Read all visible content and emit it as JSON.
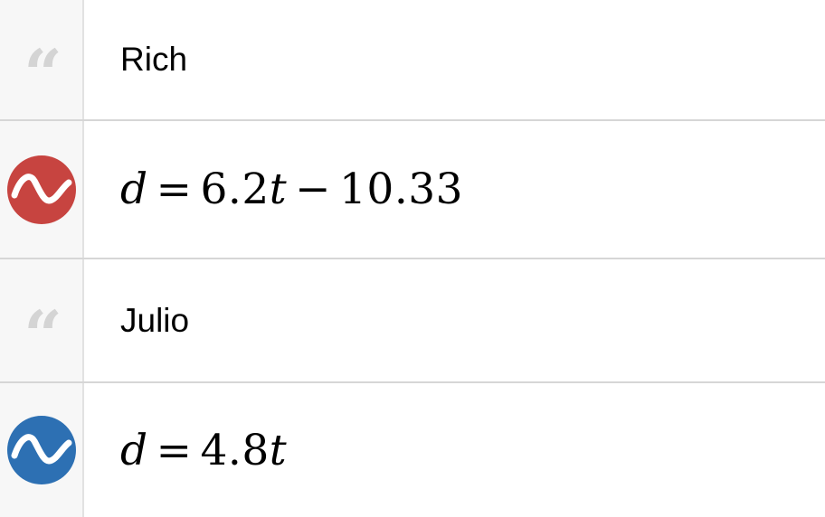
{
  "expressions": [
    {
      "kind": "note",
      "text": "Rich"
    },
    {
      "kind": "expression",
      "color": "#c74440",
      "icon": "sine-wave-icon",
      "lhs": "d",
      "eq": "=",
      "coef": "6.2",
      "var": "t",
      "op": "−",
      "constant": "10.33"
    },
    {
      "kind": "note",
      "text": "Julio"
    },
    {
      "kind": "expression",
      "color": "#2d70b3",
      "icon": "sine-wave-icon",
      "lhs": "d",
      "eq": "=",
      "coef": "4.8",
      "var": "t"
    }
  ],
  "note_icon": "quote-icon",
  "note_glyph": "“"
}
